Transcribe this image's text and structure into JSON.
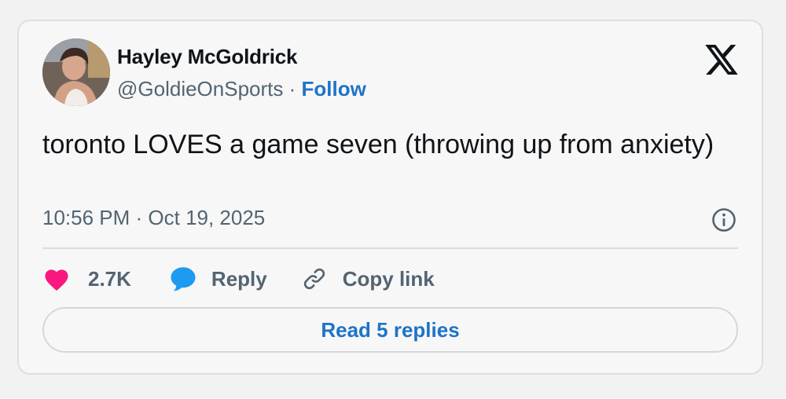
{
  "author": {
    "name": "Hayley McGoldrick",
    "handle": "@GoldieOnSports",
    "separator": "·",
    "follow_label": "Follow",
    "avatar_icon": "profile-photo"
  },
  "tweet": {
    "text": "toronto LOVES a game seven (throwing up from anxiety)",
    "timestamp": "10:56 PM · Oct 19, 2025"
  },
  "actions": {
    "like_count": "2.7K",
    "reply_label": "Reply",
    "copy_link_label": "Copy link"
  },
  "footer": {
    "read_replies_label": "Read 5 replies"
  },
  "colors": {
    "accent": "#1d74c8",
    "like": "#f91880",
    "reply_icon": "#1d9bf0",
    "muted": "#536471"
  }
}
